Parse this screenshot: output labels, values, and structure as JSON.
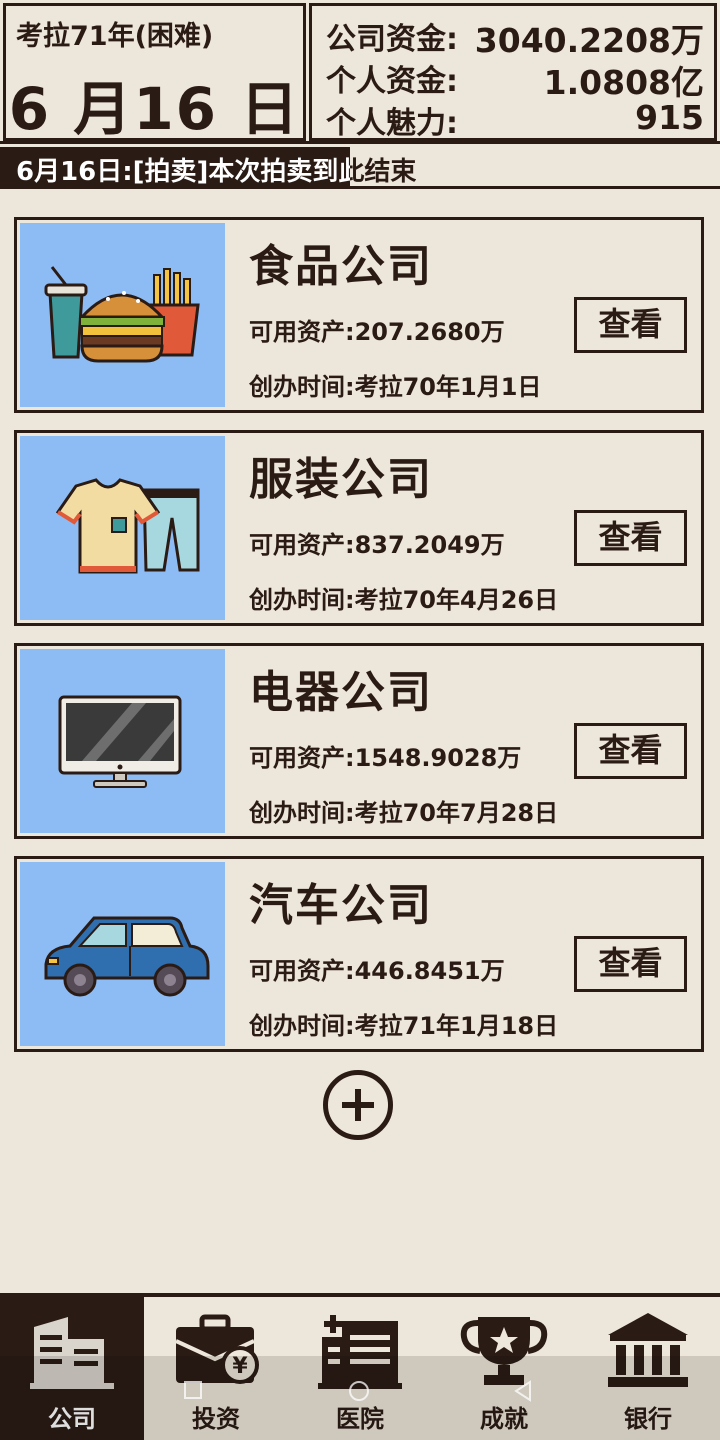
{
  "header": {
    "year_label": "考拉71年(困难)",
    "date": "6 月16 日",
    "stats": [
      {
        "label": "公司资金:",
        "value": "3040.2208万"
      },
      {
        "label": "个人资金:",
        "value": "1.0808亿"
      },
      {
        "label": "个人魅力:",
        "value": "915"
      }
    ],
    "news": "6月16日:[拍卖]本次拍卖到此结束"
  },
  "companies": [
    {
      "name": "食品公司",
      "assets": "可用资产:207.2680万",
      "founded": "创办时间:考拉70年1月1日",
      "button": "查看",
      "icon": "burger-fries-icon"
    },
    {
      "name": "服装公司",
      "assets": "可用资产:837.2049万",
      "founded": "创办时间:考拉70年4月26日",
      "button": "查看",
      "icon": "shirt-pants-icon"
    },
    {
      "name": "电器公司",
      "assets": "可用资产:1548.9028万",
      "founded": "创办时间:考拉70年7月28日",
      "button": "查看",
      "icon": "monitor-icon"
    },
    {
      "name": "汽车公司",
      "assets": "可用资产:446.8451万",
      "founded": "创办时间:考拉71年1月18日",
      "button": "查看",
      "icon": "car-icon"
    }
  ],
  "add_icon": "plus-circle-icon",
  "nav": [
    {
      "label": "公司",
      "icon": "building-icon",
      "active": true
    },
    {
      "label": "投资",
      "icon": "briefcase-yen-icon",
      "active": false
    },
    {
      "label": "医院",
      "icon": "hospital-icon",
      "active": false
    },
    {
      "label": "成就",
      "icon": "trophy-icon",
      "active": false
    },
    {
      "label": "银行",
      "icon": "bank-icon",
      "active": false
    }
  ],
  "colors": {
    "background": "#ede6da",
    "ink": "#2b1b15",
    "card_image_bg": "#8dbcf5"
  }
}
